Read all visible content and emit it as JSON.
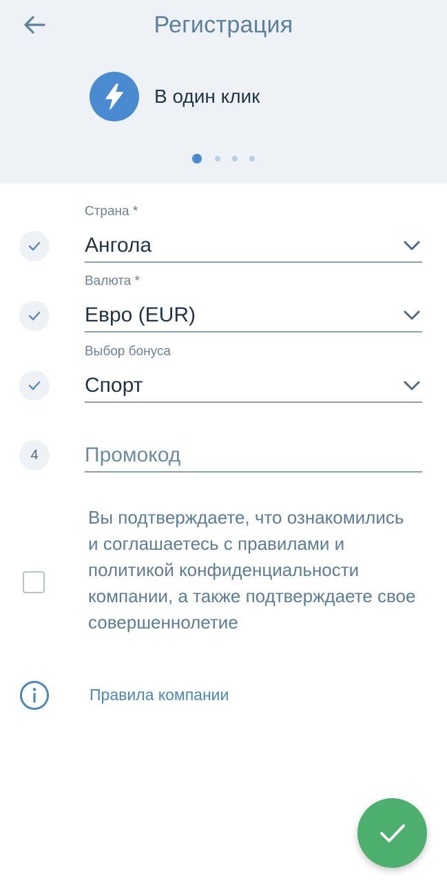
{
  "header": {
    "title": "Регистрация",
    "method_label": "В один клик",
    "pages": 4,
    "active_page": 1
  },
  "form": {
    "country": {
      "label": "Страна *",
      "value": "Ангола"
    },
    "currency": {
      "label": "Валюта *",
      "value": "Евро (EUR)"
    },
    "bonus": {
      "label": "Выбор бонуса",
      "value": "Спорт"
    },
    "promo": {
      "step": "4",
      "placeholder": "Промокод",
      "value": ""
    }
  },
  "consent": {
    "text": "Вы подтверждаете, что ознакомились и соглашаетесь с правилами и политикой конфиденциальности компании, а также подтверждаете свое совершеннолетие",
    "checked": false
  },
  "rules_link": "Правила компании",
  "colors": {
    "header_bg": "#eef2f6",
    "title": "#5b809c",
    "accent_blue": "#4a8ad0",
    "fab_green": "#4caf6e",
    "link": "#4c86bc"
  },
  "icons": {
    "back": "arrow-left-icon",
    "method": "lightning-bolt-icon",
    "done": "check-icon",
    "info": "info-icon",
    "dropdown": "chevron-down-icon"
  }
}
